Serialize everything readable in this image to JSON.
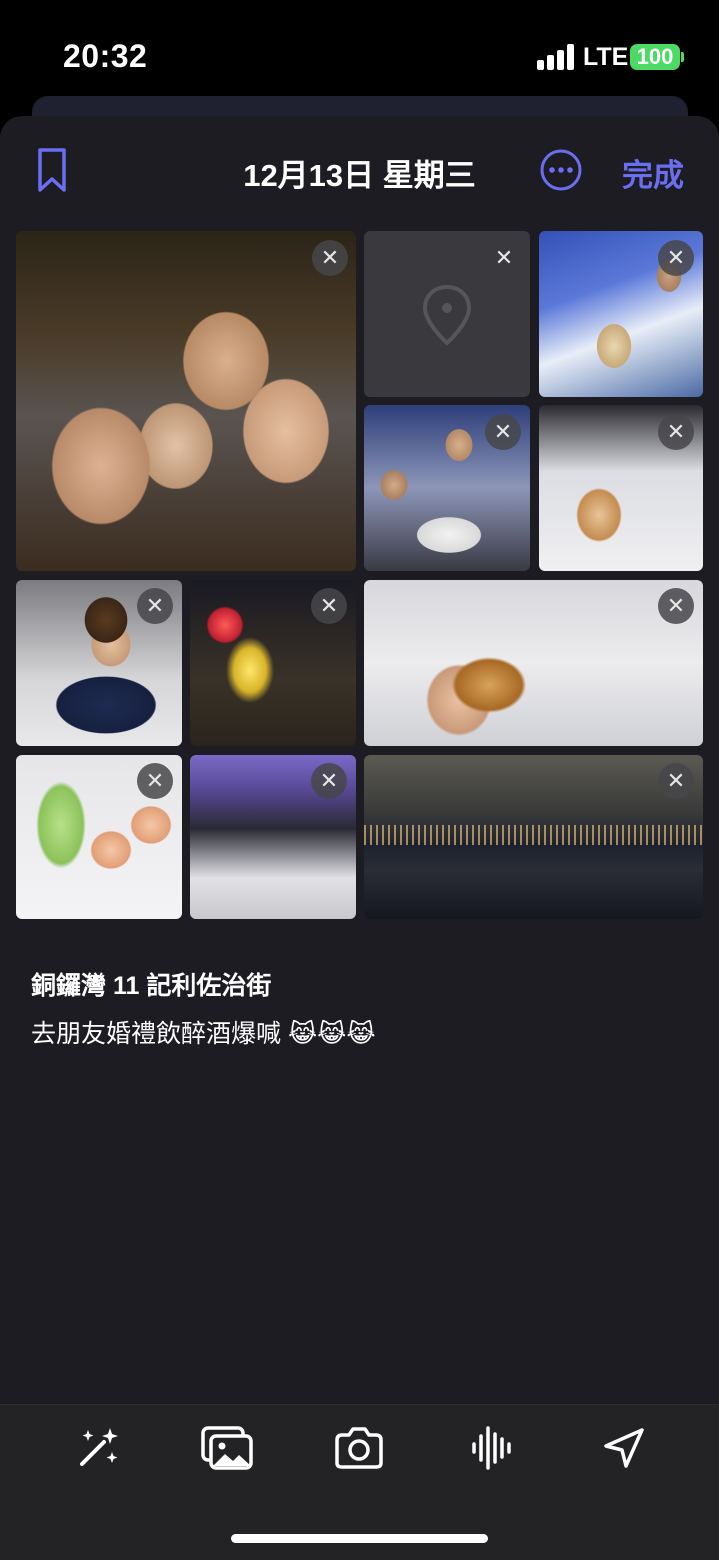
{
  "status_bar": {
    "time": "20:32",
    "network": "LTE",
    "battery": "100"
  },
  "header": {
    "title": "12月13日 星期三",
    "done_label": "完成",
    "bookmark_icon": "bookmark-icon",
    "more_icon": "ellipsis-circle-icon"
  },
  "photos": [
    {
      "label": "group-selfie-night"
    },
    {
      "label": "location-placeholder",
      "icon": "map-pin-icon"
    },
    {
      "label": "cocktail-drink"
    },
    {
      "label": "friends-at-table"
    },
    {
      "label": "whisky-glass-hand"
    },
    {
      "label": "child-with-phone"
    },
    {
      "label": "neon-star-sign"
    },
    {
      "label": "whisky-glass-closeup"
    },
    {
      "label": "shrimp-dish"
    },
    {
      "label": "banquet-hall"
    },
    {
      "label": "harbour-night-view"
    }
  ],
  "entry": {
    "location": "銅鑼灣 11 記利佐治街",
    "text": "去朋友婚禮飲醉酒爆喊 😹😹😹"
  },
  "toolbar": {
    "items": [
      "magic-wand-icon",
      "photo-library-icon",
      "camera-icon",
      "audio-waveform-icon",
      "location-arrow-icon"
    ]
  },
  "colors": {
    "accent": "#6b6ef0",
    "sheet_bg": "#1c1c22",
    "battery": "#4cd964"
  }
}
